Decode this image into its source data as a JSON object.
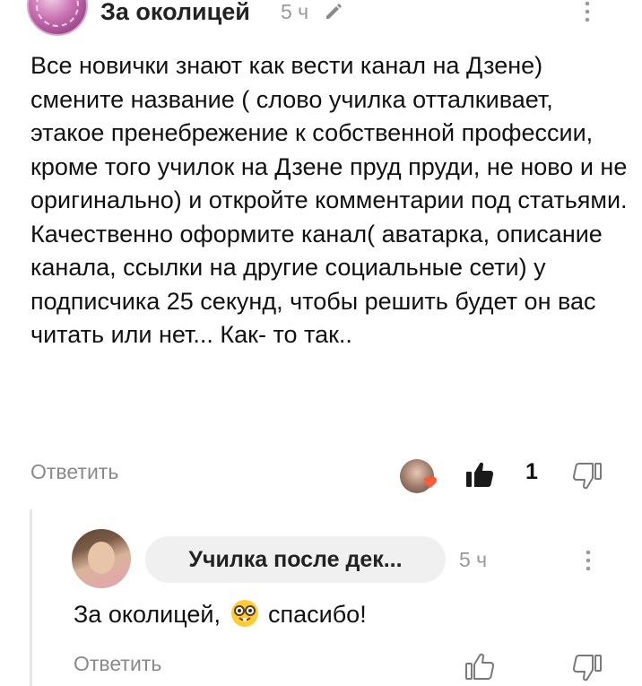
{
  "comment": {
    "author": "За околицей",
    "time": "5 ч",
    "text": "Все новички знают как вести канал на Дзене) смените название ( слово училка отталкивает, этакое пренебрежение к собственной профессии, кроме того училок на Дзене пруд пруди, не ново и не оригинально) и откройте комментарии под статьями. Качественно оформите канал( аватарка, описание канала, ссылки на другие социальные сети) у подписчика 25 секунд, чтобы решить будет он вас читать или нет... Как- то так..",
    "reply_label": "Ответить",
    "like_count": "1"
  },
  "reply": {
    "author": "Училка после дек...",
    "time": "5 ч",
    "text_before": "За околицей, ",
    "text_after": "спасибо!",
    "emoji": "nerd-face-emoji",
    "reply_label": "Ответить"
  },
  "icons": {
    "edit": "pencil-icon",
    "more": "more-vertical-icon",
    "like": "thumbs-up-icon",
    "dislike": "thumbs-down-icon",
    "heart": "heart-icon"
  },
  "colors": {
    "muted": "#8a8a8a",
    "pill_bg": "#f0f0f0",
    "heart": "#ff5a3c"
  }
}
